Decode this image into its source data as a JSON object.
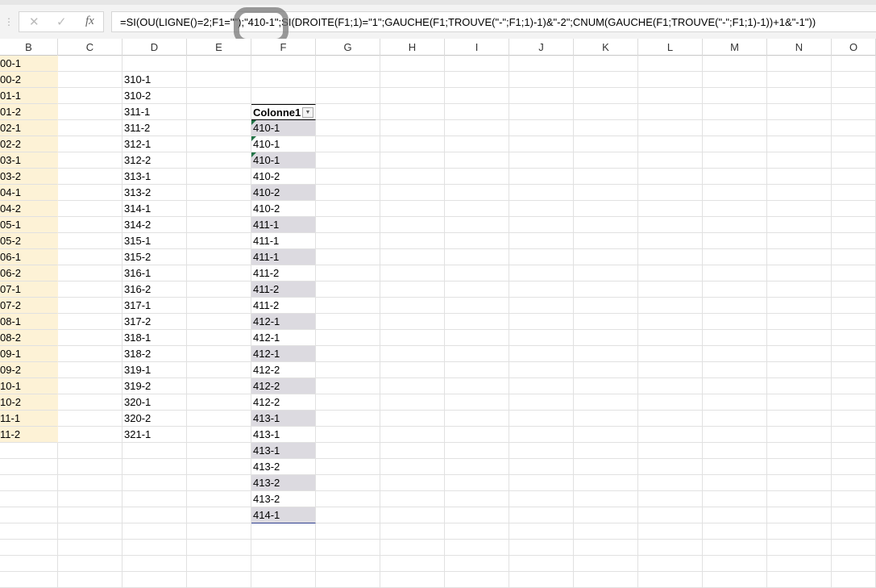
{
  "formula_bar": {
    "cancel_icon": "✕",
    "enter_icon": "✓",
    "fx_label": "fx",
    "formula": "=SI(OU(LIGNE()=2;F1=\"\");\"410-1\";SI(DROITE(F1;1)=\"1\";GAUCHE(F1;TROUVE(\"-\";F1;1)-1)&\"-2\";CNUM(GAUCHE(F1;TROUVE(\"-\";F1;1)-1))+1&\"-1\"))"
  },
  "columns": [
    "B",
    "C",
    "D",
    "E",
    "F",
    "G",
    "H",
    "I",
    "J",
    "K",
    "L",
    "M",
    "N",
    "O"
  ],
  "col_b": [
    "00-1",
    "00-2",
    "01-1",
    "01-2",
    "02-1",
    "02-2",
    "03-1",
    "03-2",
    "04-1",
    "04-2",
    "05-1",
    "05-2",
    "06-1",
    "06-2",
    "07-1",
    "07-2",
    "08-1",
    "08-2",
    "09-1",
    "09-2",
    "10-1",
    "10-2",
    "11-1",
    "11-2"
  ],
  "col_d": [
    "310-1",
    "310-2",
    "311-1",
    "311-2",
    "312-1",
    "312-2",
    "313-1",
    "313-2",
    "314-1",
    "314-2",
    "315-1",
    "315-2",
    "316-1",
    "316-2",
    "317-1",
    "317-2",
    "318-1",
    "318-2",
    "319-1",
    "319-2",
    "320-1",
    "320-2",
    "321-1"
  ],
  "table": {
    "header": "Colonne1",
    "values": [
      "410-1",
      "410-1",
      "410-1",
      "410-2",
      "410-2",
      "410-2",
      "411-1",
      "411-1",
      "411-1",
      "411-2",
      "411-2",
      "411-2",
      "412-1",
      "412-1",
      "412-1",
      "412-2",
      "412-2",
      "412-2",
      "413-1",
      "413-1",
      "413-1",
      "413-2",
      "413-2",
      "413-2",
      "414-1"
    ]
  },
  "colors": {
    "band": "#dcdae0",
    "col_b_fill": "#fdf2d6",
    "error_triangle": "#217346"
  }
}
